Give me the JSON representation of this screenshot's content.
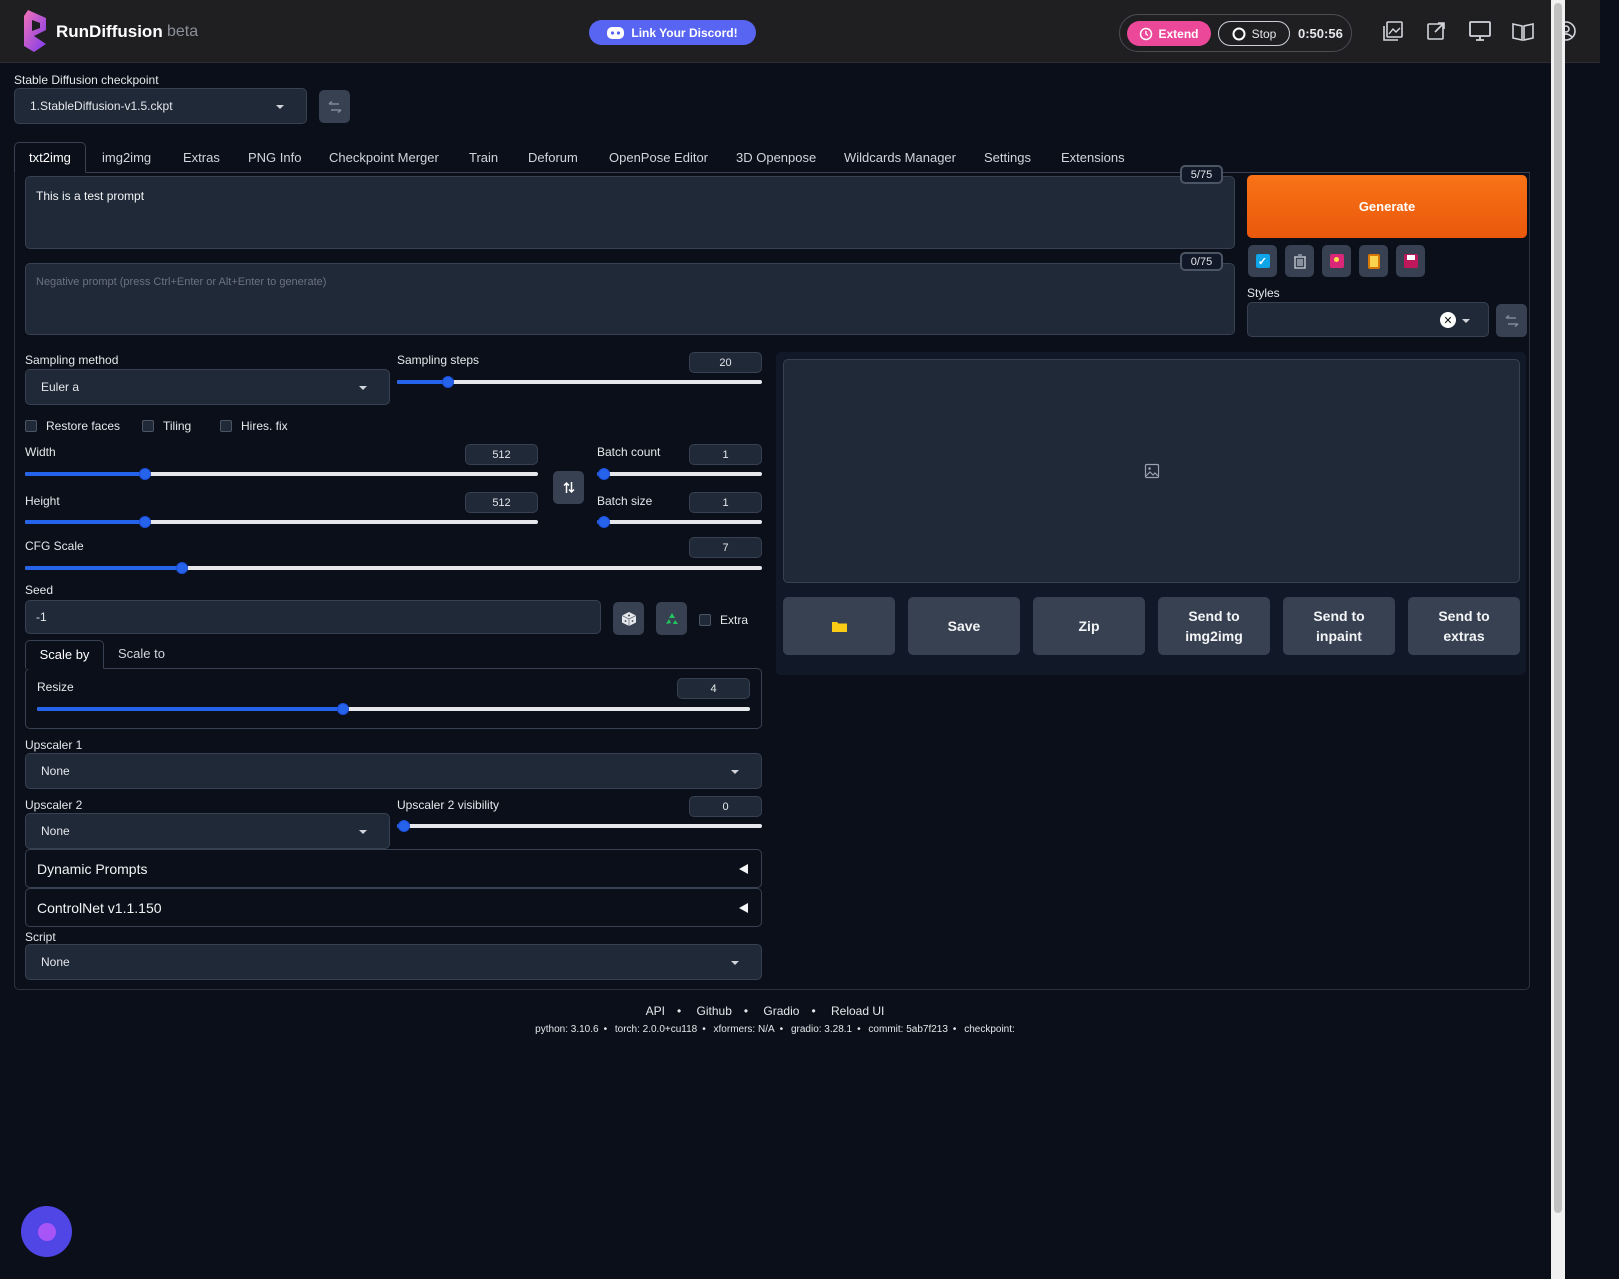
{
  "header": {
    "brand": "RunDiffusion",
    "beta": "beta",
    "discord_label": "Link Your Discord!",
    "extend_label": "Extend",
    "stop_label": "Stop",
    "timer": "0:50:56"
  },
  "checkpoint": {
    "label": "Stable Diffusion checkpoint",
    "value": "1.StableDiffusion-v1.5.ckpt"
  },
  "tabs": [
    "txt2img",
    "img2img",
    "Extras",
    "PNG Info",
    "Checkpoint Merger",
    "Train",
    "Deforum",
    "OpenPose Editor",
    "3D Openpose",
    "Wildcards Manager",
    "Settings",
    "Extensions"
  ],
  "prompt": {
    "value": "This is a test prompt",
    "counter": "5/75",
    "negative_placeholder": "Negative prompt (press Ctrl+Enter or Alt+Enter to generate)",
    "negative_counter": "0/75"
  },
  "generate_label": "Generate",
  "styles_label": "Styles",
  "sampling": {
    "method_label": "Sampling method",
    "method_value": "Euler a",
    "steps_label": "Sampling steps",
    "steps_value": "20"
  },
  "checks": {
    "restore_faces": "Restore faces",
    "tiling": "Tiling",
    "hires_fix": "Hires. fix",
    "extra": "Extra"
  },
  "width": {
    "label": "Width",
    "value": "512"
  },
  "height": {
    "label": "Height",
    "value": "512"
  },
  "batch_count": {
    "label": "Batch count",
    "value": "1"
  },
  "batch_size": {
    "label": "Batch size",
    "value": "1"
  },
  "cfg": {
    "label": "CFG Scale",
    "value": "7"
  },
  "seed": {
    "label": "Seed",
    "value": "-1"
  },
  "hires": {
    "tab_scale_by": "Scale by",
    "tab_scale_to": "Scale to",
    "resize_label": "Resize",
    "resize_value": "4",
    "upscaler1_label": "Upscaler 1",
    "upscaler1_value": "None",
    "upscaler2_label": "Upscaler 2",
    "upscaler2_value": "None",
    "visibility_label": "Upscaler 2 visibility",
    "visibility_value": "0"
  },
  "accordions": {
    "dynamic_prompts": "Dynamic Prompts",
    "controlnet": "ControlNet v1.1.150"
  },
  "script": {
    "label": "Script",
    "value": "None"
  },
  "output_buttons": {
    "save": "Save",
    "zip": "Zip",
    "send_img2img_1": "Send to",
    "send_img2img_2": "img2img",
    "send_inpaint_1": "Send to",
    "send_inpaint_2": "inpaint",
    "send_extras_1": "Send to",
    "send_extras_2": "extras"
  },
  "footer": {
    "api": "API",
    "github": "Github",
    "gradio": "Gradio",
    "reload": "Reload UI",
    "python": "python: 3.10.6",
    "torch": "torch: 2.0.0+cu118",
    "xformers": "xformers: N/A",
    "gradio_ver": "gradio: 3.28.1",
    "commit": "commit: 5ab7f213",
    "checkpoint": "checkpoint:"
  },
  "icons": [
    "rundiffusion-logo-icon",
    "discord-icon",
    "extend-clock-icon",
    "stop-circle-icon",
    "gallery-icon",
    "external-link-icon",
    "monitor-icon",
    "docs-icon",
    "account-icon",
    "refresh-icon",
    "swap-icon",
    "dice-icon",
    "recycle-icon",
    "folder-icon",
    "image-placeholder-icon",
    "chat-icon"
  ],
  "colors": {
    "accent": "#2563eb",
    "generate": "#f97316",
    "extend": "#ec4899",
    "discord": "#5865f2"
  }
}
